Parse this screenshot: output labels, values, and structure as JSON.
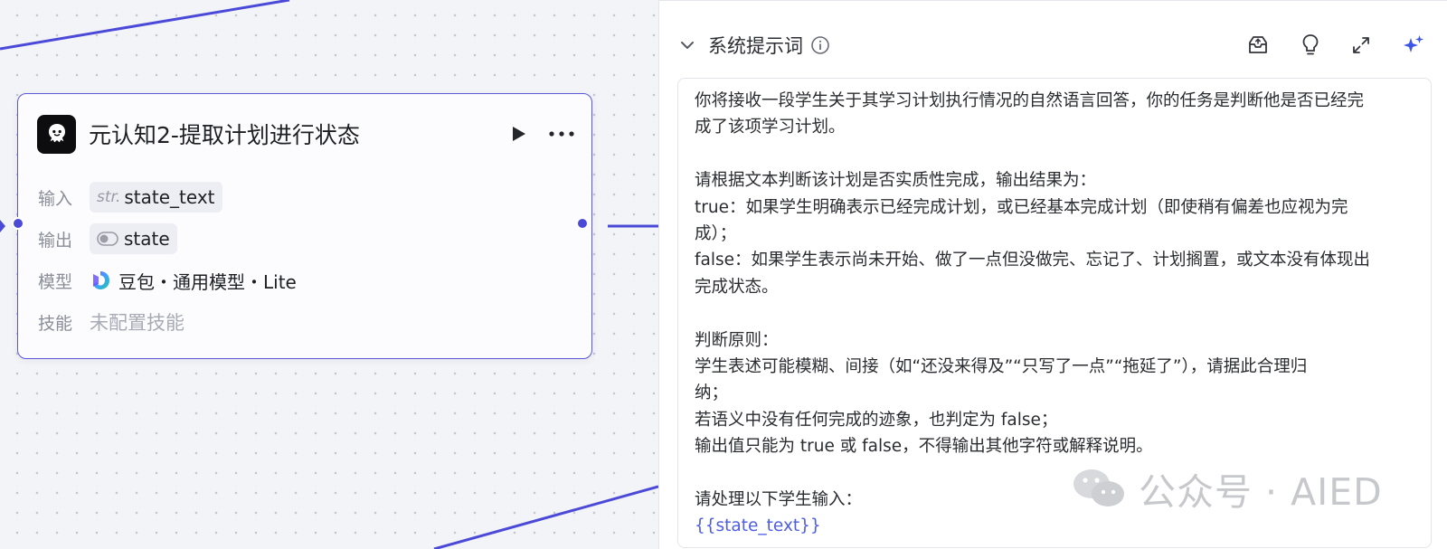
{
  "node": {
    "title": "元认知2-提取计划进行状态",
    "input_label": "输入",
    "input_type": "str.",
    "input_value": "state_text",
    "output_label": "输出",
    "output_value": "state",
    "model_label": "模型",
    "model_value": "豆包・通用模型・Lite",
    "skill_label": "技能",
    "skill_value": "未配置技能",
    "accent_color": "#4b4ad8"
  },
  "panel": {
    "title": "系统提示词",
    "prompt_lines": [
      "你将接收一段学生关于其学习计划执行情况的自然语言回答，你的任务是判断他是否已经完",
      "成了该项学习计划。",
      "",
      "请根据文本判断该计划是否实质性完成，输出结果为：",
      "true：如果学生明确表示已经完成计划，或已经基本完成计划（即使稍有偏差也应视为完",
      "成）；",
      "false：如果学生表示尚未开始、做了一点但没做完、忘记了、计划搁置，或文本没有体现出",
      "完成状态。",
      "",
      "判断原则：",
      "学生表述可能模糊、间接（如“还没来得及”“只写了一点”“拖延了”），请据此合理归",
      "纳；",
      "若语义中没有任何完成的迹象，也判定为 false；",
      "输出值只能为 true 或 false，不得输出其他字符或解释说明。",
      "",
      "请处理以下学生输入：",
      "{{state_text}}"
    ],
    "tools": [
      "inbox-icon",
      "lightbulb-icon",
      "expand-icon",
      "sparkle-icon"
    ]
  },
  "watermark": {
    "text": "公众号 · AIED"
  }
}
